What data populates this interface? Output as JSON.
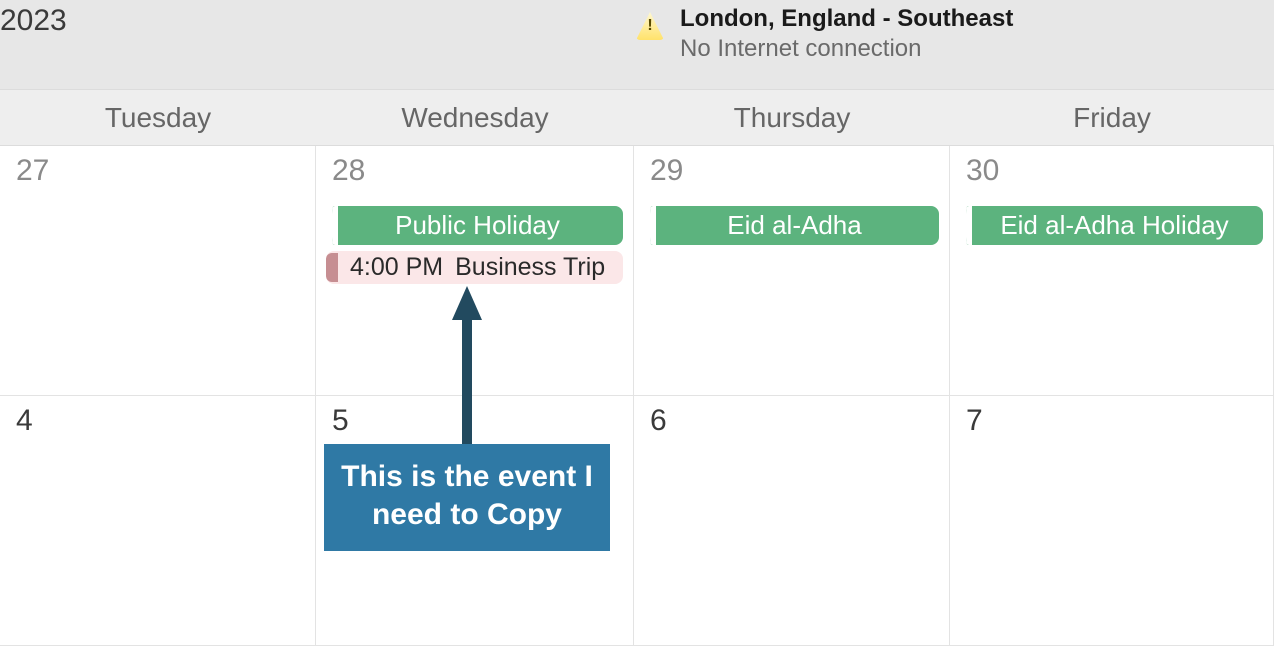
{
  "header": {
    "title_fragment": " 2023",
    "location": "London, England - Southeast",
    "status": "No Internet connection"
  },
  "day_headers": [
    "Tuesday",
    "Wednesday",
    "Thursday",
    "Friday"
  ],
  "weeks": [
    {
      "cells": [
        {
          "day": "27",
          "muted": true
        },
        {
          "day": "28",
          "muted": true,
          "green_event": "Public Holiday",
          "timed_event": {
            "time": "4:00 PM",
            "title": "Business Trip"
          }
        },
        {
          "day": "29",
          "muted": true,
          "green_event": "Eid al-Adha"
        },
        {
          "day": "30",
          "muted": true,
          "green_event": "Eid al-Adha Holiday"
        }
      ]
    },
    {
      "cells": [
        {
          "day": "4"
        },
        {
          "day": "5"
        },
        {
          "day": "6"
        },
        {
          "day": "7"
        }
      ]
    }
  ],
  "callout": "This is the event I need to Copy"
}
